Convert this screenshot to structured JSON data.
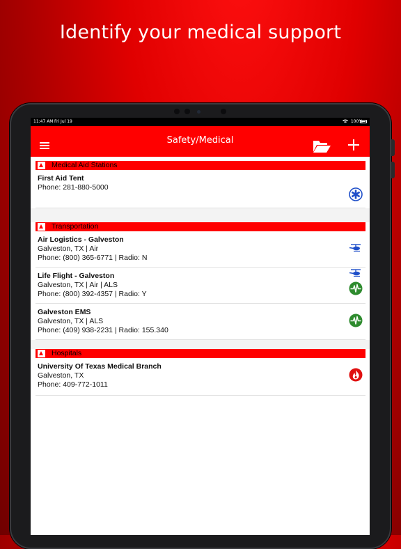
{
  "headline": "Identify your medical support",
  "status_bar": {
    "time": "11:47 AM",
    "date": "Fri Jul 19",
    "battery": "100%"
  },
  "navbar": {
    "title": "Safety/Medical",
    "icons": [
      "menu-icon",
      "folder-open-icon",
      "plus-icon"
    ]
  },
  "colors": {
    "accent": "#ff0000",
    "background_dark": "#700000",
    "icon_blue": "#1f4fc9",
    "icon_green": "#2e8b2e",
    "icon_red": "#e01010"
  },
  "sections": [
    {
      "title": "Medical Aid Stations",
      "entries": [
        {
          "name": "First Aid Tent",
          "line2": "Phone: 281-880-5000",
          "icons": [
            "star-of-life-icon"
          ]
        }
      ]
    },
    {
      "title": "Transportation",
      "entries": [
        {
          "name": "Air Logistics - Galveston",
          "line2": "Galveston, TX | Air",
          "line3": "Phone: (800) 365-6771 | Radio: N",
          "icons": [
            "helicopter-icon"
          ]
        },
        {
          "name": "Life Flight - Galveston",
          "line2": "Galveston, TX | Air | ALS",
          "line3": "Phone: (800) 392-4357 | Radio: Y",
          "icons": [
            "helicopter-icon",
            "heartbeat-icon"
          ]
        },
        {
          "name": "Galveston EMS",
          "line2": "Galveston, TX | ALS",
          "line3": "Phone: (409) 938-2231 | Radio: 155.340",
          "icons": [
            "heartbeat-icon"
          ]
        }
      ]
    },
    {
      "title": "Hospitals",
      "entries": [
        {
          "name": "University Of Texas Medical Branch",
          "line2": "Galveston, TX",
          "line3": "Phone: 409-772-1011",
          "icons": [
            "burn-center-flame-icon"
          ]
        }
      ]
    }
  ]
}
